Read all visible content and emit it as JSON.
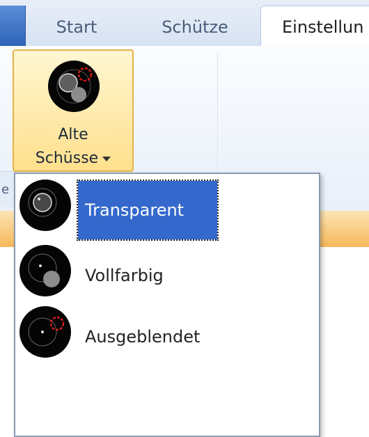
{
  "tabs": [
    {
      "label": "Start"
    },
    {
      "label": "Schütze"
    },
    {
      "label": "Einstellun"
    }
  ],
  "group_label_partial": "e",
  "button": {
    "line1": "Alte",
    "line2": "Schüsse",
    "icon": "old-shots-icon"
  },
  "dropdown": {
    "items": [
      {
        "label": "Transparent",
        "icon": "transparent-shots-icon",
        "selected": true
      },
      {
        "label": "Vollfarbig",
        "icon": "solid-shots-icon",
        "selected": false
      },
      {
        "label": "Ausgeblendet",
        "icon": "hidden-shots-icon",
        "selected": false
      }
    ]
  },
  "colors": {
    "ribbon_blue": "#3468cc",
    "button_highlight": "#ffe08c",
    "orange_strip": "#f6b85a",
    "shot_ring_red": "#d21b1b"
  }
}
